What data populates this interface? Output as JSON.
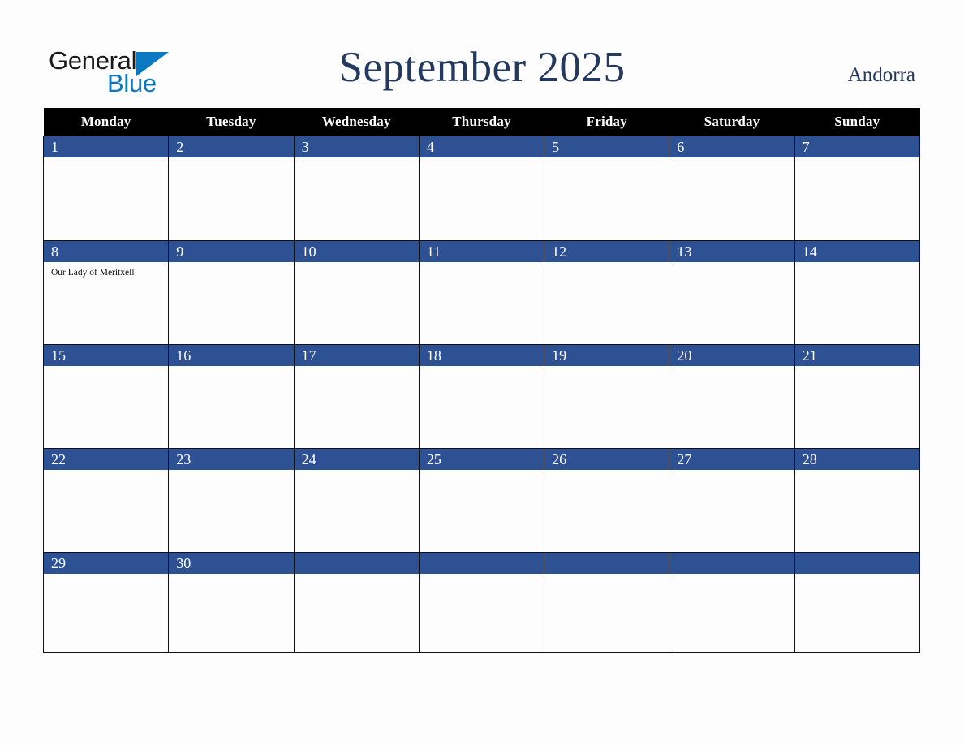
{
  "brand": {
    "name_part1": "General",
    "name_part2": "Blue",
    "triangle_icon": "triangle-icon",
    "accent_color": "#0b78c2"
  },
  "header": {
    "title": "September 2025",
    "country": "Andorra",
    "title_color": "#23395f"
  },
  "calendar": {
    "header_bg": "#000000",
    "daynum_bg": "#2d5193",
    "weekday_headers": [
      "Monday",
      "Tuesday",
      "Wednesday",
      "Thursday",
      "Friday",
      "Saturday",
      "Sunday"
    ],
    "weeks": [
      [
        {
          "day": "1",
          "events": []
        },
        {
          "day": "2",
          "events": []
        },
        {
          "day": "3",
          "events": []
        },
        {
          "day": "4",
          "events": []
        },
        {
          "day": "5",
          "events": []
        },
        {
          "day": "6",
          "events": []
        },
        {
          "day": "7",
          "events": []
        }
      ],
      [
        {
          "day": "8",
          "events": [
            "Our Lady of Meritxell"
          ]
        },
        {
          "day": "9",
          "events": []
        },
        {
          "day": "10",
          "events": []
        },
        {
          "day": "11",
          "events": []
        },
        {
          "day": "12",
          "events": []
        },
        {
          "day": "13",
          "events": []
        },
        {
          "day": "14",
          "events": []
        }
      ],
      [
        {
          "day": "15",
          "events": []
        },
        {
          "day": "16",
          "events": []
        },
        {
          "day": "17",
          "events": []
        },
        {
          "day": "18",
          "events": []
        },
        {
          "day": "19",
          "events": []
        },
        {
          "day": "20",
          "events": []
        },
        {
          "day": "21",
          "events": []
        }
      ],
      [
        {
          "day": "22",
          "events": []
        },
        {
          "day": "23",
          "events": []
        },
        {
          "day": "24",
          "events": []
        },
        {
          "day": "25",
          "events": []
        },
        {
          "day": "26",
          "events": []
        },
        {
          "day": "27",
          "events": []
        },
        {
          "day": "28",
          "events": []
        }
      ],
      [
        {
          "day": "29",
          "events": []
        },
        {
          "day": "30",
          "events": []
        },
        {
          "day": "",
          "events": []
        },
        {
          "day": "",
          "events": []
        },
        {
          "day": "",
          "events": []
        },
        {
          "day": "",
          "events": []
        },
        {
          "day": "",
          "events": []
        }
      ]
    ]
  }
}
